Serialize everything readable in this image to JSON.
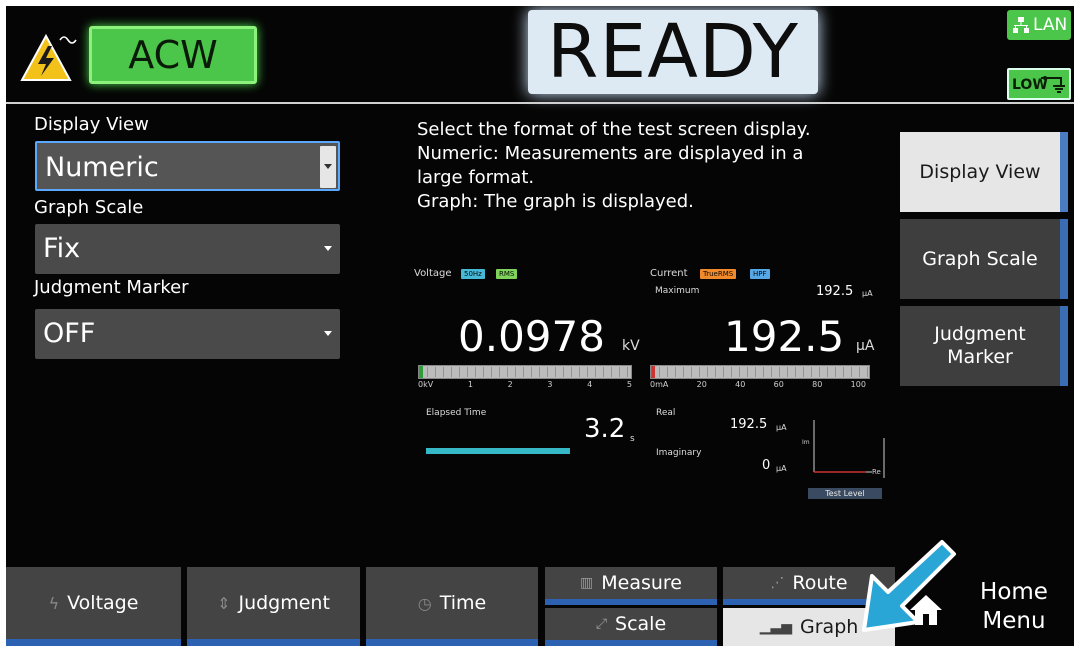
{
  "header": {
    "mode": "ACW",
    "status": "READY",
    "lan": "LAN",
    "low": "LOW"
  },
  "settings": {
    "display_view": {
      "label": "Display View",
      "value": "Numeric"
    },
    "graph_scale": {
      "label": "Graph Scale",
      "value": "Fix"
    },
    "judgment_marker": {
      "label": "Judgment Marker",
      "value": "OFF"
    }
  },
  "description": [
    "Select the format of the test screen display.",
    "Numeric: Measurements are displayed in a",
    "large format.",
    "Graph: The graph is displayed."
  ],
  "preview": {
    "voltage": {
      "label": "Voltage",
      "tag_freq": "50Hz",
      "tag_rms": "RMS",
      "value": "0.0978",
      "unit": "kV",
      "fill_fraction": 0.02,
      "scale": [
        "0kV",
        "1",
        "2",
        "3",
        "4",
        "5"
      ]
    },
    "current": {
      "label": "Current",
      "tag_truerms": "TrueRMS",
      "tag_hpf": "HPF",
      "maximum_label": "Maximum",
      "maximum_value": "192.5",
      "maximum_unit": "μA",
      "value": "192.5",
      "unit": "μA",
      "fill_fraction": 0.02,
      "scale": [
        "0mA",
        "20",
        "40",
        "60",
        "80",
        "100"
      ]
    },
    "elapsed": {
      "label": "Elapsed Time",
      "value": "3.2",
      "unit": "s"
    },
    "real": {
      "label": "Real",
      "value": "192.5",
      "unit": "μA"
    },
    "imaginary": {
      "label": "Imaginary",
      "value": "0",
      "unit": "μA"
    },
    "phasor": {
      "im_label": "Im",
      "re_label": "Re"
    },
    "test_level": "Test Level"
  },
  "side_buttons": {
    "display_view": "Display View",
    "graph_scale": "Graph Scale",
    "judgment_marker": "Judgment Marker"
  },
  "bottom": {
    "voltage": "Voltage",
    "judgment": "Judgment",
    "time": "Time",
    "measure": "Measure",
    "scale": "Scale",
    "route": "Route",
    "graph": "Graph",
    "home_line1": "Home",
    "home_line2": "Menu"
  },
  "icons": {
    "warning": "high-voltage-warning-icon",
    "home": "home-icon",
    "pointer": "pointer-arrow-icon"
  },
  "colors": {
    "mode_green": "#4cc64a",
    "accent_blue": "#2d62b3",
    "cyan_arrow": "#2aa6d6"
  }
}
